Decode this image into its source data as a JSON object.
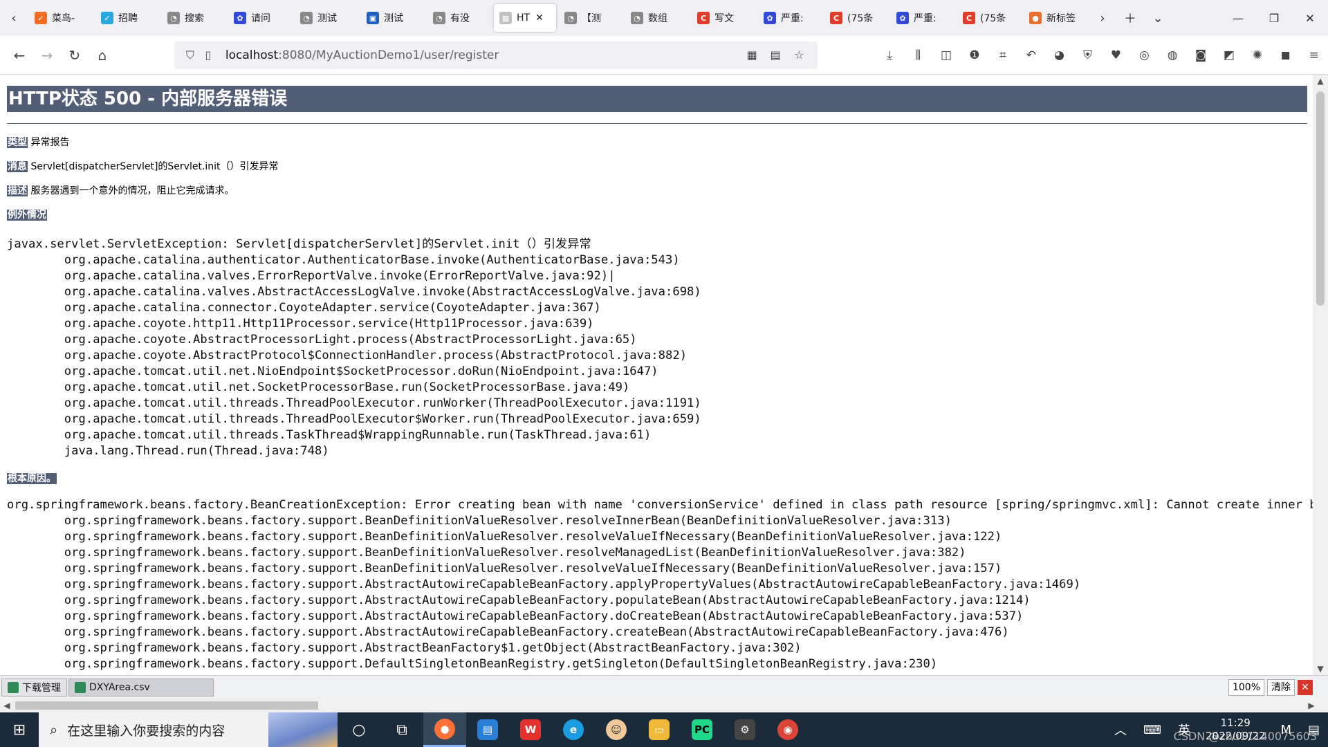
{
  "tabs": [
    {
      "label": "菜鸟-",
      "fav_color": "#f26c22",
      "fav_glyph": "✓"
    },
    {
      "label": "招聘",
      "fav_color": "#2ba7e0",
      "fav_glyph": "✓"
    },
    {
      "label": "搜索",
      "fav_color": "#888888",
      "fav_glyph": "◔"
    },
    {
      "label": "请问",
      "fav_color": "#3049d8",
      "fav_glyph": "✿"
    },
    {
      "label": "测试",
      "fav_color": "#888888",
      "fav_glyph": "◔"
    },
    {
      "label": "测试",
      "fav_color": "#1f5fbf",
      "fav_glyph": "▣"
    },
    {
      "label": "有没",
      "fav_color": "#888888",
      "fav_glyph": "◔"
    },
    {
      "label": "HT",
      "fav_color": "#c0c0c0",
      "fav_glyph": "▦",
      "active": true
    },
    {
      "label": "【测",
      "fav_color": "#888888",
      "fav_glyph": "◔"
    },
    {
      "label": "数组",
      "fav_color": "#888888",
      "fav_glyph": "◔"
    },
    {
      "label": "写文",
      "fav_color": "#e03b2b",
      "fav_glyph": "C"
    },
    {
      "label": "严重:",
      "fav_color": "#3049d8",
      "fav_glyph": "✿"
    },
    {
      "label": "(75条",
      "fav_color": "#e03b2b",
      "fav_glyph": "C"
    },
    {
      "label": "严重:",
      "fav_color": "#3049d8",
      "fav_glyph": "✿"
    },
    {
      "label": "(75条",
      "fav_color": "#e03b2b",
      "fav_glyph": "C"
    },
    {
      "label": "新标签",
      "fav_color": "#e8702a",
      "fav_glyph": "●"
    }
  ],
  "url": {
    "host": "localhost",
    "rest": ":8080/MyAuctionDemo1/user/register"
  },
  "page": {
    "title": "HTTP状态 500 - 内部服务器错误",
    "type_label": "类型",
    "type_value": " 异常报告",
    "message_label": "消息",
    "message_value": " Servlet[dispatcherServlet]的Servlet.init（）引发异常",
    "description_label": "描述",
    "description_value": " 服务器遇到一个意外的情况，阻止它完成请求。",
    "exception_label": "例外情况",
    "exception_trace": "javax.servlet.ServletException: Servlet[dispatcherServlet]的Servlet.init（）引发异常\n\torg.apache.catalina.authenticator.AuthenticatorBase.invoke(AuthenticatorBase.java:543)\n\torg.apache.catalina.valves.ErrorReportValve.invoke(ErrorReportValve.java:92)|\n\torg.apache.catalina.valves.AbstractAccessLogValve.invoke(AbstractAccessLogValve.java:698)\n\torg.apache.catalina.connector.CoyoteAdapter.service(CoyoteAdapter.java:367)\n\torg.apache.coyote.http11.Http11Processor.service(Http11Processor.java:639)\n\torg.apache.coyote.AbstractProcessorLight.process(AbstractProcessorLight.java:65)\n\torg.apache.coyote.AbstractProtocol$ConnectionHandler.process(AbstractProtocol.java:882)\n\torg.apache.tomcat.util.net.NioEndpoint$SocketProcessor.doRun(NioEndpoint.java:1647)\n\torg.apache.tomcat.util.net.SocketProcessorBase.run(SocketProcessorBase.java:49)\n\torg.apache.tomcat.util.threads.ThreadPoolExecutor.runWorker(ThreadPoolExecutor.java:1191)\n\torg.apache.tomcat.util.threads.ThreadPoolExecutor$Worker.run(ThreadPoolExecutor.java:659)\n\torg.apache.tomcat.util.threads.TaskThread$WrappingRunnable.run(TaskThread.java:61)\n\tjava.lang.Thread.run(Thread.java:748)",
    "root_cause_label": "根本原因。",
    "root_cause_trace": "org.springframework.beans.factory.BeanCreationException: Error creating bean with name 'conversionService' defined in class path resource [spring/springmvc.xml]: Cannot create inner bean 'c\n\torg.springframework.beans.factory.support.BeanDefinitionValueResolver.resolveInnerBean(BeanDefinitionValueResolver.java:313)\n\torg.springframework.beans.factory.support.BeanDefinitionValueResolver.resolveValueIfNecessary(BeanDefinitionValueResolver.java:122)\n\torg.springframework.beans.factory.support.BeanDefinitionValueResolver.resolveManagedList(BeanDefinitionValueResolver.java:382)\n\torg.springframework.beans.factory.support.BeanDefinitionValueResolver.resolveValueIfNecessary(BeanDefinitionValueResolver.java:157)\n\torg.springframework.beans.factory.support.AbstractAutowireCapableBeanFactory.applyPropertyValues(AbstractAutowireCapableBeanFactory.java:1469)\n\torg.springframework.beans.factory.support.AbstractAutowireCapableBeanFactory.populateBean(AbstractAutowireCapableBeanFactory.java:1214)\n\torg.springframework.beans.factory.support.AbstractAutowireCapableBeanFactory.doCreateBean(AbstractAutowireCapableBeanFactory.java:537)\n\torg.springframework.beans.factory.support.AbstractAutowireCapableBeanFactory.createBean(AbstractAutowireCapableBeanFactory.java:476)\n\torg.springframework.beans.factory.support.AbstractBeanFactory$1.getObject(AbstractBeanFactory.java:302)\n\torg.springframework.beans.factory.support.DefaultSingletonBeanRegistry.getSingleton(DefaultSingletonBeanRegistry.java:230)"
  },
  "downloads": {
    "manager_label": "下载管理",
    "file_label": "DXYArea.csv",
    "zoom": "100%",
    "clear_label": "清除"
  },
  "taskbar": {
    "search_placeholder": "在这里输入你要搜索的内容",
    "ime_label": "英",
    "time": "11:29",
    "date": "2022/09/22",
    "watermark": "CSDN @zhu11140075603"
  },
  "colors": {
    "error_header": "#525d76",
    "taskbar": "#1c2b3a"
  }
}
